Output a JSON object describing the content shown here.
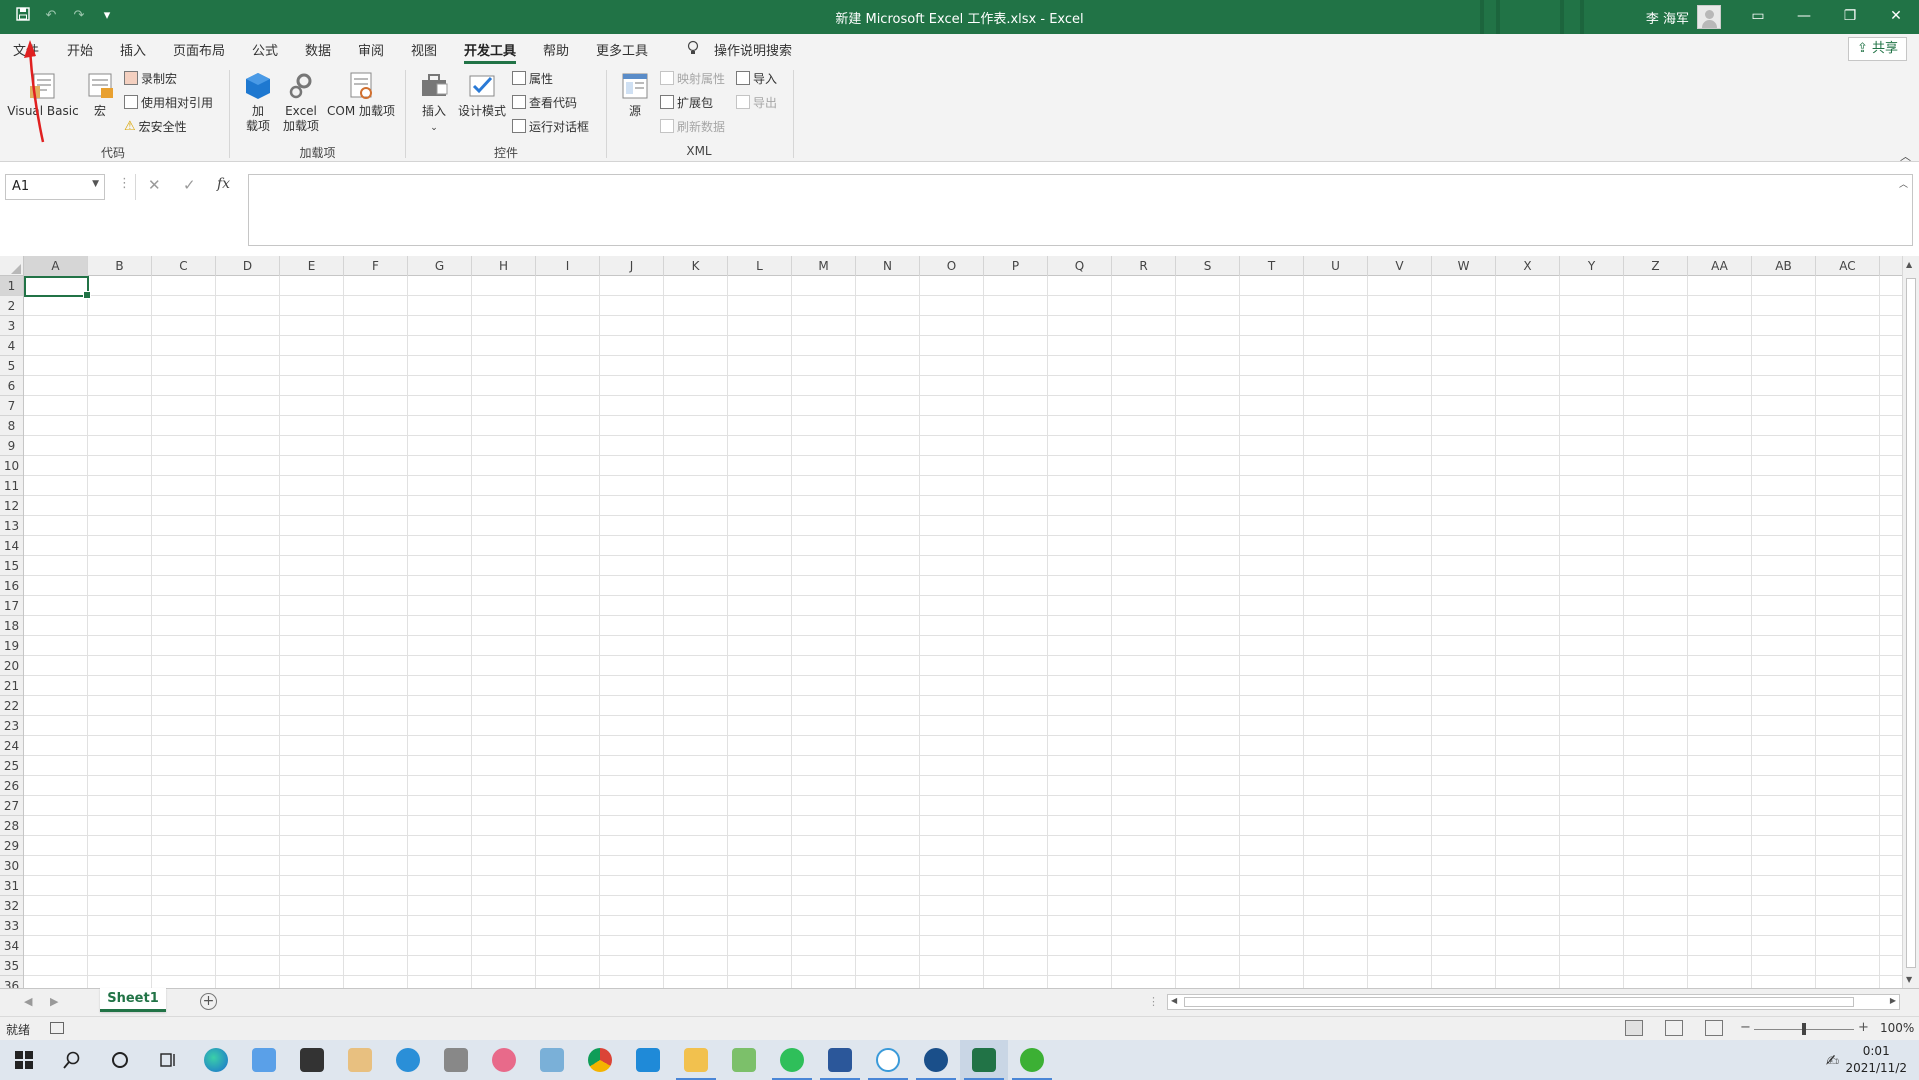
{
  "titlebar": {
    "title": "新建 Microsoft Excel 工作表.xlsx  -  Excel",
    "user": "李 海军",
    "icons": [
      "save-icon",
      "undo-icon",
      "redo-icon",
      "customize-qat-icon"
    ],
    "window_buttons": [
      "ribbon-display-options-icon",
      "minimize-icon",
      "restore-icon",
      "close-icon"
    ]
  },
  "tabs": {
    "file": "文件",
    "home": "开始",
    "insert": "插入",
    "layout": "页面布局",
    "formulas": "公式",
    "data": "数据",
    "review": "审阅",
    "view": "视图",
    "developer": "开发工具",
    "help": "帮助",
    "more": "更多工具",
    "tell_me": "操作说明搜索",
    "share": "共享"
  },
  "ribbon": {
    "code": {
      "label": "代码",
      "visual_basic": "Visual Basic",
      "macros": "宏",
      "record_macro": "录制宏",
      "relative_ref": "使用相对引用",
      "macro_security": "宏安全性"
    },
    "addins": {
      "label": "加载项",
      "addins_line1": "加",
      "addins_line2": "载项",
      "excel_addins_line1": "Excel",
      "excel_addins_line2": "加载项",
      "com_addins": "COM 加载项"
    },
    "controls": {
      "label": "控件",
      "insert": "插入",
      "design_mode": "设计模式",
      "properties": "属性",
      "view_code": "查看代码",
      "run_dialog": "运行对话框"
    },
    "xml": {
      "label": "XML",
      "source": "源",
      "map_properties": "映射属性",
      "expansion_packs": "扩展包",
      "refresh_data": "刷新数据",
      "import": "导入",
      "export": "导出"
    }
  },
  "formula_bar": {
    "name_box": "A1",
    "cancel": "✕",
    "enter": "✓",
    "fx": "fx",
    "value": ""
  },
  "grid": {
    "columns": [
      "A",
      "B",
      "C",
      "D",
      "E",
      "F",
      "G",
      "H",
      "I",
      "J",
      "K",
      "L",
      "M",
      "N",
      "O",
      "P",
      "Q",
      "R",
      "S",
      "T",
      "U",
      "V",
      "W",
      "X",
      "Y",
      "Z",
      "AA",
      "AB",
      "AC"
    ],
    "rows": [
      "1",
      "2",
      "3",
      "4",
      "5",
      "6",
      "7",
      "8",
      "9",
      "10",
      "11",
      "12",
      "13",
      "14",
      "15",
      "16",
      "17",
      "18",
      "19",
      "20",
      "21",
      "22",
      "23",
      "24",
      "25",
      "26",
      "27",
      "28",
      "29",
      "30",
      "31",
      "32",
      "33",
      "34",
      "35",
      "36"
    ],
    "selected_cell": "A1"
  },
  "sheets": {
    "tabs": [
      "Sheet1"
    ],
    "active": "Sheet1",
    "add": "+"
  },
  "status": {
    "ready": "就绪",
    "zoom_minus": "−",
    "zoom_plus": "+",
    "zoom": "100%",
    "zoom_level": 1.0
  },
  "taskbar": {
    "time": "0:01",
    "date": "2021/11/2",
    "apps": [
      "start-icon",
      "search-icon",
      "cortana-icon",
      "task-view-icon",
      "edge-icon",
      "app-icon",
      "store-icon",
      "paint-icon",
      "ie-icon",
      "photos-icon",
      "snip-icon",
      "app2-icon",
      "chrome-icon",
      "vscode-icon",
      "explorer-icon",
      "notepad-icon",
      "app3-icon",
      "word-icon",
      "app4-icon",
      "app5-icon",
      "excel-icon",
      "wechat-icon"
    ]
  },
  "colors": {
    "excel_green": "#217346",
    "taskbar": "#dfe6ee",
    "annotation": "#e02020"
  }
}
